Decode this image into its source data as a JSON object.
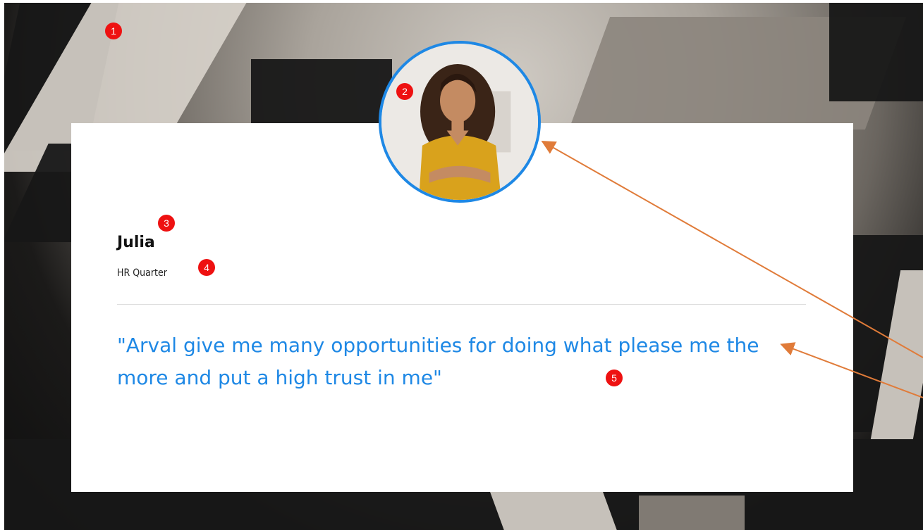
{
  "profile": {
    "name": "Julia",
    "role": "HR Quarter"
  },
  "quote": {
    "text": "\"Arval give me many opportunities for doing what please me the more and put a high trust in me\""
  },
  "markers": [
    "1",
    "2",
    "3",
    "4",
    "5"
  ],
  "colors": {
    "accent": "#1e88e5",
    "marker": "#ee1111",
    "arrow": "#e07b39"
  }
}
